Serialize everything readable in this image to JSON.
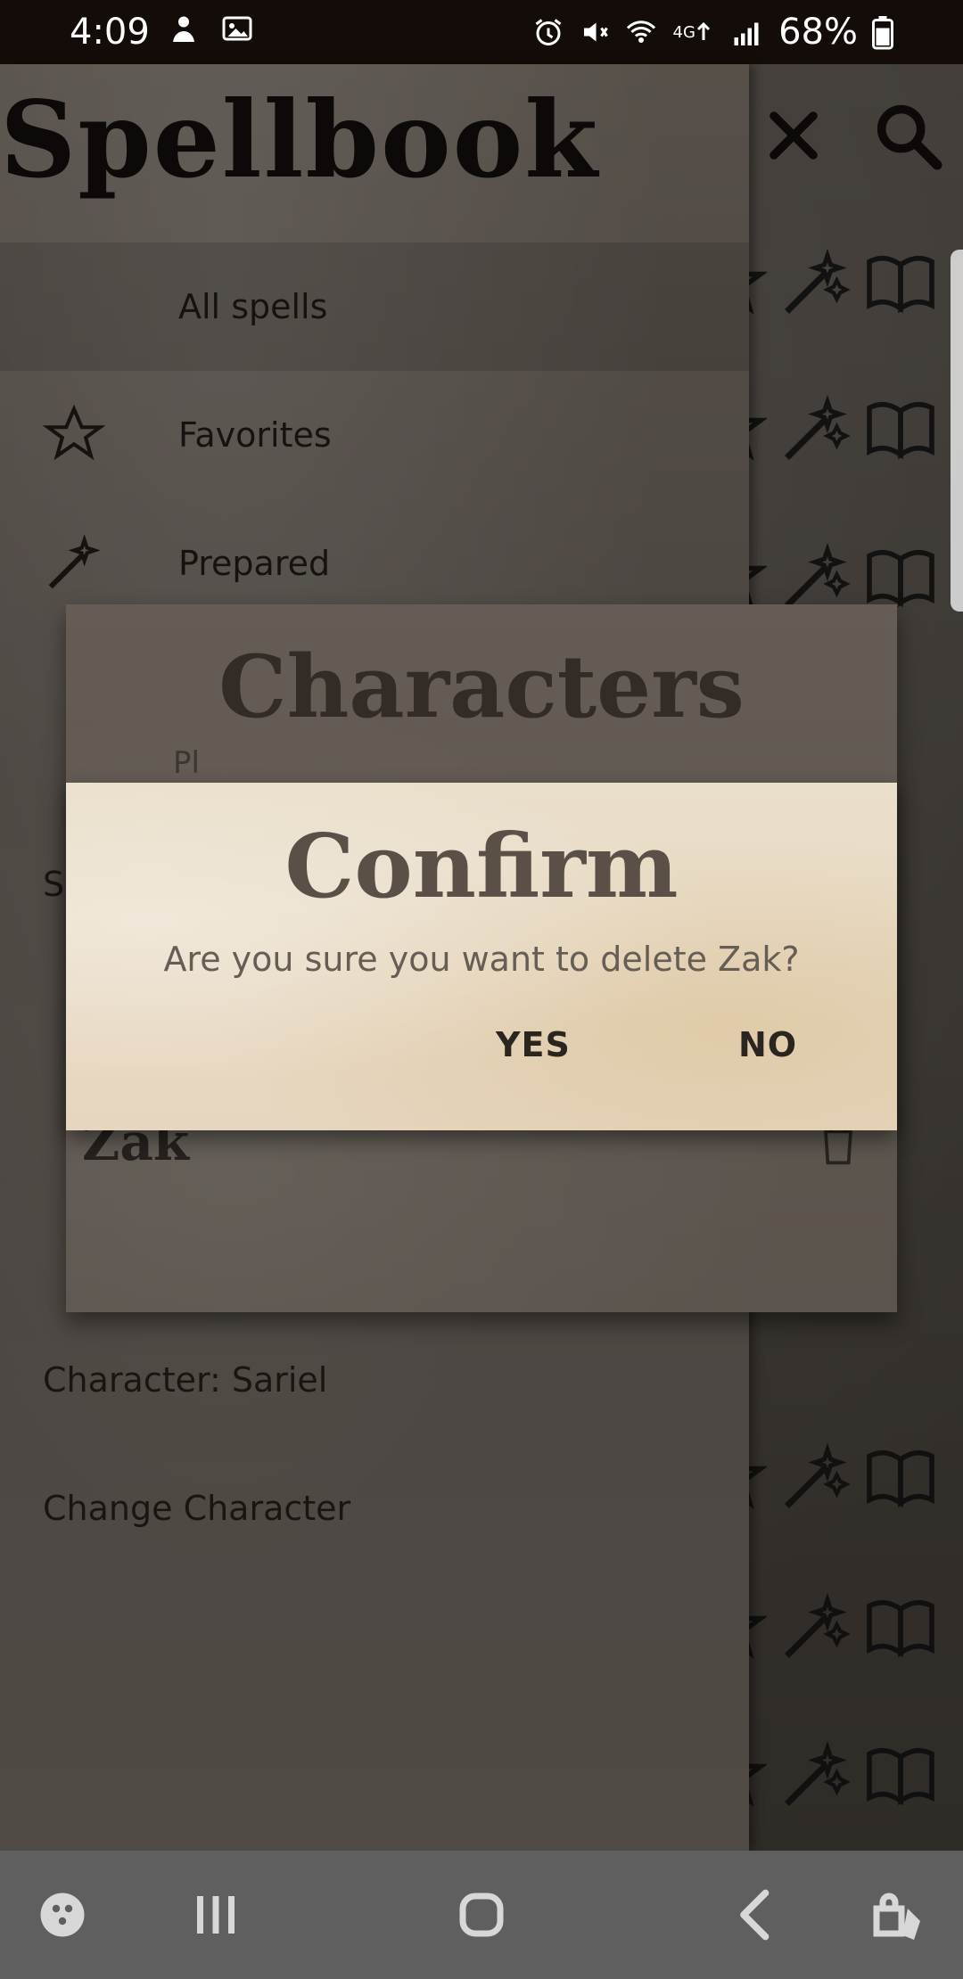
{
  "status_bar": {
    "time": "4:09",
    "battery_percent": "68%",
    "network": "4G",
    "icons_left": [
      "person-icon",
      "image-icon"
    ],
    "icons_right": [
      "alarm-icon",
      "mute-icon",
      "wifi-icon",
      "4g-icon",
      "signal-icon",
      "battery-icon"
    ]
  },
  "app": {
    "title": "Spellbook",
    "header_actions": [
      "close-icon",
      "search-icon"
    ]
  },
  "drawer": {
    "items": [
      {
        "label": "All spells",
        "icon": "",
        "selected": true
      },
      {
        "label": "Favorites",
        "icon": "star-icon",
        "selected": false
      },
      {
        "label": "Prepared",
        "icon": "wand-icon",
        "selected": false
      }
    ],
    "character_label": "Character: Sariel",
    "change_character_label": "Change Character",
    "section_initial": "S"
  },
  "characters_dialog": {
    "title": "Characters",
    "partial_text": "Pl",
    "characters": [
      "Zak"
    ]
  },
  "confirm_dialog": {
    "title": "Confirm",
    "message": "Are you sure you want to delete Zak?",
    "yes_label": "YES",
    "no_label": "NO"
  },
  "nav_bar": {
    "icons": [
      "game-icon",
      "recents-icon",
      "home-icon",
      "back-icon",
      "accessibility-icon"
    ]
  },
  "colors": {
    "status_bar": "#140c08",
    "drawer": "#625b55",
    "confirm_paper": "#e6d6bf",
    "nav_bar": "#5f5f5f"
  }
}
